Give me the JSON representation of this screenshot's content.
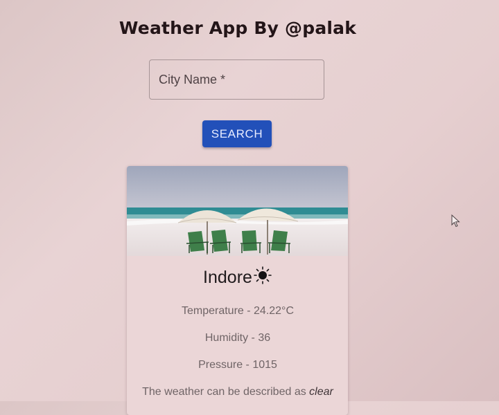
{
  "header": {
    "title": "Weather App By @palak"
  },
  "search": {
    "placeholder": "City Name *",
    "value": "",
    "button_label": "SEARCH"
  },
  "weather": {
    "city": "Indore",
    "icon": "sun-icon",
    "temperature_label": "Temperature",
    "temperature": "24.22°C",
    "humidity_label": "Humidity",
    "humidity": "36",
    "pressure_label": "Pressure",
    "pressure": "1015",
    "description_prefix": "The weather can be described as",
    "description": "clear"
  },
  "image": {
    "icon": "beach-image"
  },
  "colors": {
    "accent": "#2250b9",
    "background": "#e6cfd0",
    "card": "#ebd6d7",
    "title": "#231518"
  }
}
